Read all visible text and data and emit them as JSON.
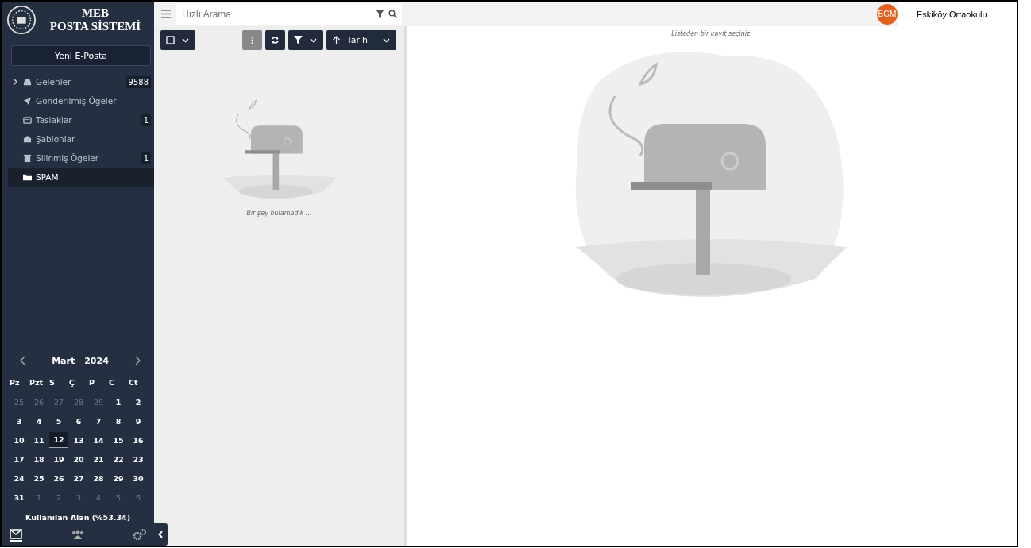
{
  "brand": {
    "line1": "MEB",
    "line2": "POSTA SİSTEMİ"
  },
  "compose": "Yeni E-Posta",
  "folders": [
    {
      "label": "Gelenler",
      "count": "9588",
      "selected": false
    },
    {
      "label": "Gönderilmiş Ögeler",
      "selected": false
    },
    {
      "label": "Taslaklar",
      "count": "1",
      "selected": false
    },
    {
      "label": "Şablonlar",
      "selected": false
    },
    {
      "label": "Silinmiş Ögeler",
      "count": "1",
      "selected": false
    },
    {
      "label": "SPAM",
      "selected": true
    }
  ],
  "calendar": {
    "month": "Mart",
    "year": "2024",
    "weekdays": [
      "Pz",
      "Pzt",
      "S",
      "Ç",
      "P",
      "C",
      "Ct"
    ],
    "weeks": [
      [
        {
          "d": "25",
          "muted": true,
          "selected": false
        },
        {
          "d": "26",
          "muted": true,
          "selected": false
        },
        {
          "d": "27",
          "muted": true,
          "selected": false
        },
        {
          "d": "28",
          "muted": true,
          "selected": false
        },
        {
          "d": "29",
          "muted": true,
          "selected": false
        },
        {
          "d": "1",
          "muted": false,
          "selected": false
        },
        {
          "d": "2",
          "muted": false,
          "selected": false
        }
      ],
      [
        {
          "d": "3",
          "muted": false,
          "selected": false
        },
        {
          "d": "4",
          "muted": false,
          "selected": false
        },
        {
          "d": "5",
          "muted": false,
          "selected": false
        },
        {
          "d": "6",
          "muted": false,
          "selected": false
        },
        {
          "d": "7",
          "muted": false,
          "selected": false
        },
        {
          "d": "8",
          "muted": false,
          "selected": false
        },
        {
          "d": "9",
          "muted": false,
          "selected": false
        }
      ],
      [
        {
          "d": "10",
          "muted": false,
          "selected": false
        },
        {
          "d": "11",
          "muted": false,
          "selected": false
        },
        {
          "d": "12",
          "muted": false,
          "selected": true
        },
        {
          "d": "13",
          "muted": false,
          "selected": false
        },
        {
          "d": "14",
          "muted": false,
          "selected": false
        },
        {
          "d": "15",
          "muted": false,
          "selected": false
        },
        {
          "d": "16",
          "muted": false,
          "selected": false
        }
      ],
      [
        {
          "d": "17",
          "muted": false,
          "selected": false
        },
        {
          "d": "18",
          "muted": false,
          "selected": false
        },
        {
          "d": "19",
          "muted": false,
          "selected": false
        },
        {
          "d": "20",
          "muted": false,
          "selected": false
        },
        {
          "d": "21",
          "muted": false,
          "selected": false
        },
        {
          "d": "22",
          "muted": false,
          "selected": false
        },
        {
          "d": "23",
          "muted": false,
          "selected": false
        }
      ],
      [
        {
          "d": "24",
          "muted": false,
          "selected": false
        },
        {
          "d": "25",
          "muted": false,
          "selected": false
        },
        {
          "d": "26",
          "muted": false,
          "selected": false
        },
        {
          "d": "27",
          "muted": false,
          "selected": false
        },
        {
          "d": "28",
          "muted": false,
          "selected": false
        },
        {
          "d": "29",
          "muted": false,
          "selected": false
        },
        {
          "d": "30",
          "muted": false,
          "selected": false
        }
      ],
      [
        {
          "d": "31",
          "muted": false,
          "selected": false
        },
        {
          "d": "1",
          "muted": true,
          "selected": false
        },
        {
          "d": "2",
          "muted": true,
          "selected": false
        },
        {
          "d": "3",
          "muted": true,
          "selected": false
        },
        {
          "d": "4",
          "muted": true,
          "selected": false
        },
        {
          "d": "5",
          "muted": true,
          "selected": false
        },
        {
          "d": "6",
          "muted": true,
          "selected": false
        }
      ]
    ]
  },
  "storage": "Kullanılan Alan (%53.34)",
  "bottom_nav": [
    {
      "selected": true
    },
    {
      "selected": false
    },
    {
      "selected": false
    }
  ],
  "search": {
    "placeholder": "Hızlı Arama"
  },
  "sort_label": "Tarih",
  "empty_list": "Bir şey bulamadık ...",
  "preview_hint": "Listeden bir kayıt seçiniz.",
  "user": {
    "initials": "BGM",
    "org": "Eskiköy Ortaokulu"
  }
}
